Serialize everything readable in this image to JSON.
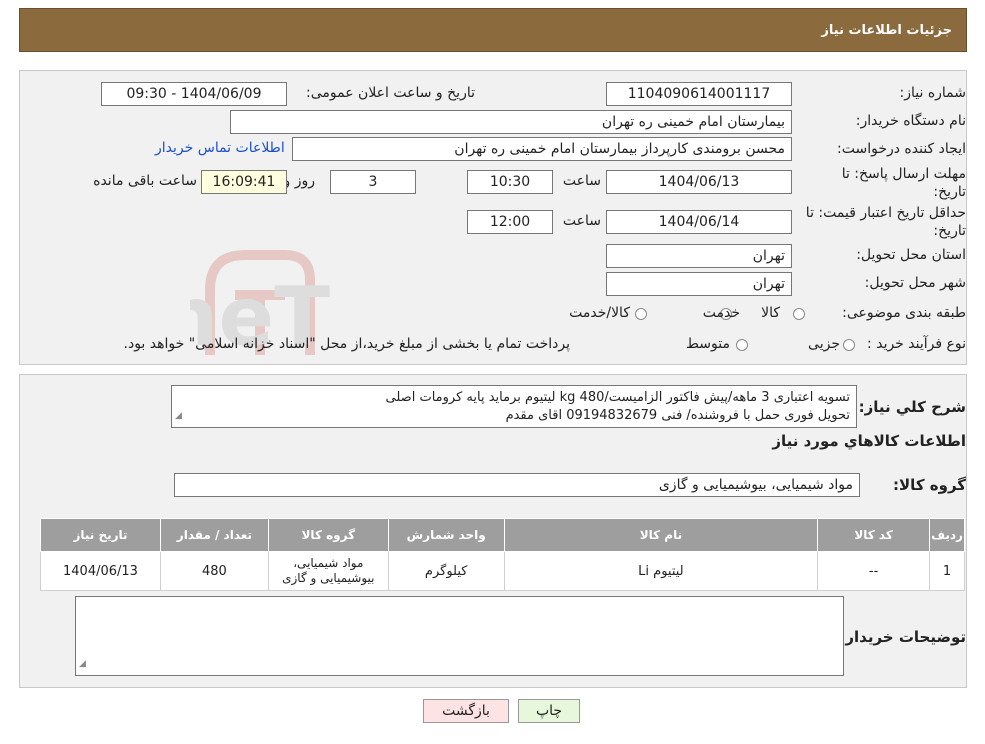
{
  "header": {
    "title": "جزئیات اطلاعات نیاز"
  },
  "form": {
    "need_number_label": "شماره نیاز:",
    "need_number": "1104090614001117",
    "announce_label": "تاریخ و ساعت اعلان عمومی:",
    "announce_value": "1404/06/09 - 09:30",
    "buyer_org_label": "نام دستگاه خریدار:",
    "buyer_org": "بیمارستان امام خمینی ره  تهران",
    "creator_label": "ایجاد کننده درخواست:",
    "creator": "محسن برومندی کارپرداز بیمارستان امام خمینی ره  تهران",
    "contact_link": "اطلاعات تماس خریدار",
    "deadline_label_1": "مهلت ارسال پاسخ: تا",
    "deadline_label_2": "تاریخ:",
    "deadline_date": "1404/06/13",
    "time_label": "ساعت",
    "deadline_time": "10:30",
    "days_value": "3",
    "days_label": "روز و",
    "remaining_time": "16:09:41",
    "remaining_label": "ساعت باقی مانده",
    "validity_label_1": "حداقل تاریخ اعتبار قیمت: تا",
    "validity_label_2": "تاریخ:",
    "validity_date": "1404/06/14",
    "validity_time_label": "ساعت",
    "validity_time": "12:00",
    "province_label": "استان محل تحویل:",
    "province": "تهران",
    "city_label": "شهر محل تحویل:",
    "city": "تهران",
    "category_label": "طبقه بندی موضوعی:",
    "category_options": [
      "کالا",
      "خدمت",
      "کالا/خدمت"
    ],
    "process_label": "نوع فرآیند خرید :",
    "process_options": [
      "جزیی",
      "متوسط"
    ],
    "process_note": "پرداخت تمام یا بخشی از مبلغ خرید،از محل \"اسناد خزانه اسلامی\" خواهد بود."
  },
  "description": {
    "label": "شرح کلي نياز:",
    "line1": "تسویه اعتباری 3 ماهه/پیش فاکتور الزامیست/480 kg لیتیوم برماید پایه کرومات اصلی",
    "line2": "تحویل فوری حمل با فروشنده/ فنی 09194832679 اقای مقدم"
  },
  "goods": {
    "section_title": "اطلاعات کالاهاي مورد نياز",
    "group_label": "گروه کالا:",
    "group_value": "مواد شیمیایی، بیوشیمیایی و  گازی"
  },
  "table": {
    "headers": [
      "ردیف",
      "کد کالا",
      "نام کالا",
      "واحد شمارش",
      "گروه کالا",
      "تعداد / مقدار",
      "تاریخ نیاز"
    ],
    "rows": [
      [
        "1",
        "--",
        "لیتیوم Li",
        "کیلوگرم",
        "مواد شیمیایی، بیوشیمیایی و گازی",
        "480",
        "1404/06/13"
      ]
    ]
  },
  "buyer_notes": {
    "label": "توضیحات خریدار:",
    "value": ""
  },
  "buttons": {
    "print": "چاپ",
    "back": "بازگشت"
  },
  "watermark": {
    "text": "AriaTender.neT"
  },
  "colors": {
    "header_bg": "#8b6b3d",
    "link": "#1a4fd0",
    "print_btn": "#e6f7dc",
    "back_btn": "#fde3e3",
    "table_header": "#9e9e9e"
  }
}
